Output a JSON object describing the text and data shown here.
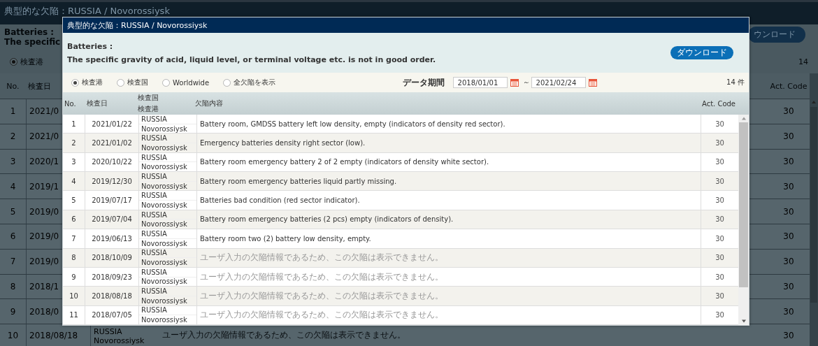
{
  "background": {
    "title": "典型的な欠陥：RUSSIA / Novorossiysk",
    "category": "Batteries :",
    "description": "The specific",
    "download_button": "ウンロード",
    "radio": {
      "label": "検査港",
      "selected": true
    },
    "count": "14",
    "columns": [
      "No.",
      "検査日",
      "Act. Code"
    ],
    "rows": [
      {
        "no": "1",
        "date": "2021/0",
        "code": "30"
      },
      {
        "no": "2",
        "date": "2021/0",
        "code": "30"
      },
      {
        "no": "3",
        "date": "2020/1",
        "code": "30"
      },
      {
        "no": "4",
        "date": "2019/1",
        "code": "30"
      },
      {
        "no": "5",
        "date": "2019/0",
        "code": "30"
      },
      {
        "no": "6",
        "date": "2019/0",
        "code": "30"
      },
      {
        "no": "7",
        "date": "2019/0",
        "code": "30"
      },
      {
        "no": "8",
        "date": "2018/1",
        "code": "30"
      },
      {
        "no": "9",
        "date": "2018/0",
        "code": "30"
      },
      {
        "no": "10",
        "date": "2018/08/18",
        "country": "RUSSIA",
        "port": "Novorossiysk",
        "content": "ユーザ入力の欠陥情報であるため、この欠陥は表示できません。",
        "code": "30"
      }
    ]
  },
  "dialog": {
    "title": "典型的な欠陥：RUSSIA / Novorossiysk",
    "category": "Batteries :",
    "description": "The specific gravity of acid, liquid level, or terminal voltage etc. is not in good order.",
    "download_button": "ダウンロード",
    "scope_options": [
      {
        "label": "検査港",
        "selected": true
      },
      {
        "label": "検査国",
        "selected": false
      },
      {
        "label": "Worldwide",
        "selected": false
      },
      {
        "label": "全欠陥を表示",
        "selected": false
      }
    ],
    "period_label": "データ期間",
    "date_from": "2018/01/01",
    "separator": "～",
    "date_to": "2021/02/24",
    "count": "14 件",
    "columns": {
      "no": "No.",
      "date": "検査日",
      "country": "検査国",
      "port": "検査港",
      "content": "欠陥内容",
      "code": "Act. Code"
    },
    "rows": [
      {
        "no": "1",
        "date": "2021/01/22",
        "country": "RUSSIA",
        "port": "Novorossiysk",
        "content": "Battery room, GMDSS battery left low density, empty (indicators of density red sector).",
        "code": "30",
        "greyed": false
      },
      {
        "no": "2",
        "date": "2021/01/02",
        "country": "RUSSIA",
        "port": "Novorossiysk",
        "content": "Emergency batteries density right sector (low).",
        "code": "30",
        "greyed": false
      },
      {
        "no": "3",
        "date": "2020/10/22",
        "country": "RUSSIA",
        "port": "Novorossiysk",
        "content": "Battery room emergency battery 2 of 2 empty (indicators of density white sector).",
        "code": "30",
        "greyed": false
      },
      {
        "no": "4",
        "date": "2019/12/30",
        "country": "RUSSIA",
        "port": "Novorossiysk",
        "content": "Battery room emergency batteries liquid partly missing.",
        "code": "30",
        "greyed": false
      },
      {
        "no": "5",
        "date": "2019/07/17",
        "country": "RUSSIA",
        "port": "Novorossiysk",
        "content": "Batteries bad condition (red sector indicator).",
        "code": "30",
        "greyed": false
      },
      {
        "no": "6",
        "date": "2019/07/04",
        "country": "RUSSIA",
        "port": "Novorossiysk",
        "content": "Battery room emergency batteries (2 pcs) empty (indicators of density).",
        "code": "30",
        "greyed": false
      },
      {
        "no": "7",
        "date": "2019/06/13",
        "country": "RUSSIA",
        "port": "Novorossiysk",
        "content": "Battery room two (2) battery low density, empty.",
        "code": "30",
        "greyed": false
      },
      {
        "no": "8",
        "date": "2018/10/09",
        "country": "RUSSIA",
        "port": "Novorossiysk",
        "content": "ユーザ入力の欠陥情報であるため、この欠陥は表示できません。",
        "code": "30",
        "greyed": true
      },
      {
        "no": "9",
        "date": "2018/09/23",
        "country": "RUSSIA",
        "port": "Novorossiysk",
        "content": "ユーザ入力の欠陥情報であるため、この欠陥は表示できません。",
        "code": "30",
        "greyed": true
      },
      {
        "no": "10",
        "date": "2018/08/18",
        "country": "RUSSIA",
        "port": "Novorossiysk",
        "content": "ユーザ入力の欠陥情報であるため、この欠陥は表示できません。",
        "code": "30",
        "greyed": true
      },
      {
        "no": "11",
        "date": "2018/07/05",
        "country": "RUSSIA",
        "port": "Novorossiysk",
        "content": "ユーザ入力の欠陥情報であるため、この欠陥は表示できません。",
        "code": "30",
        "greyed": true
      }
    ]
  }
}
